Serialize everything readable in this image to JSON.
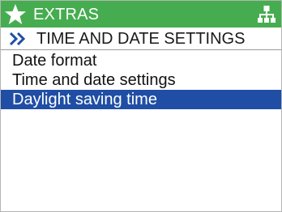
{
  "colors": {
    "header_bg": "#45ad4f",
    "selection_bg": "#1f4ea4",
    "chevron": "#1f4ea4"
  },
  "header": {
    "icon": "star-icon",
    "title": "EXTRAS",
    "right_icon": "menu-tree-icon"
  },
  "subheader": {
    "icon": "double-chevron-right-icon",
    "title": "TIME AND DATE SETTINGS"
  },
  "menu": {
    "items": [
      {
        "label": "Date format",
        "selected": false
      },
      {
        "label": "Time and date settings",
        "selected": false
      },
      {
        "label": "Daylight saving time",
        "selected": true
      }
    ]
  }
}
